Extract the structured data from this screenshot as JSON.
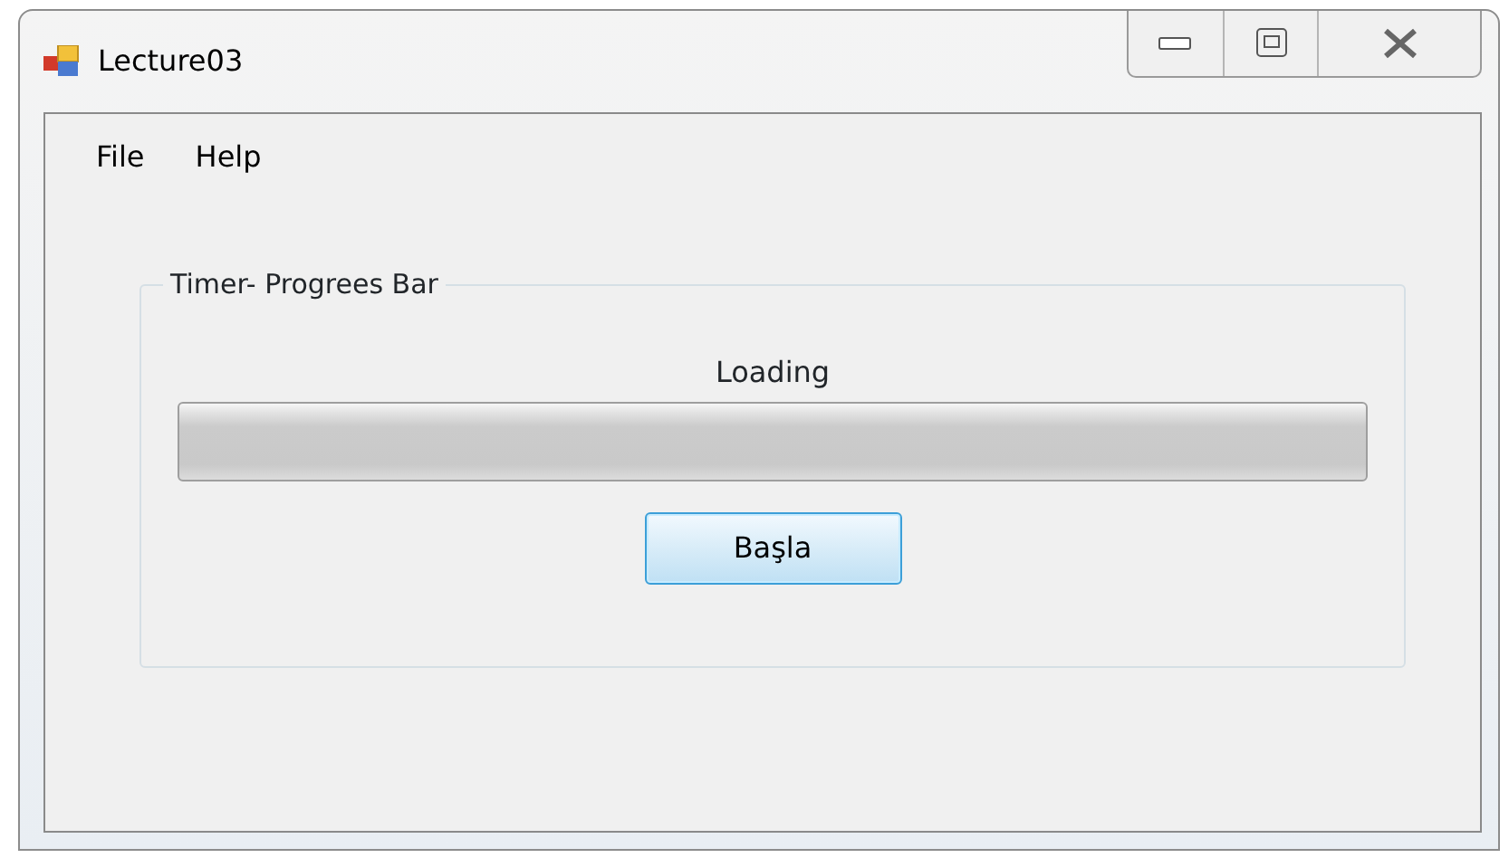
{
  "window": {
    "title": "Lecture03"
  },
  "menu": [
    "File",
    "Help"
  ],
  "group": {
    "title": "Timer- Progrees Bar",
    "label": "Loading",
    "progress": {
      "level": 0
    },
    "button": "Başla"
  }
}
